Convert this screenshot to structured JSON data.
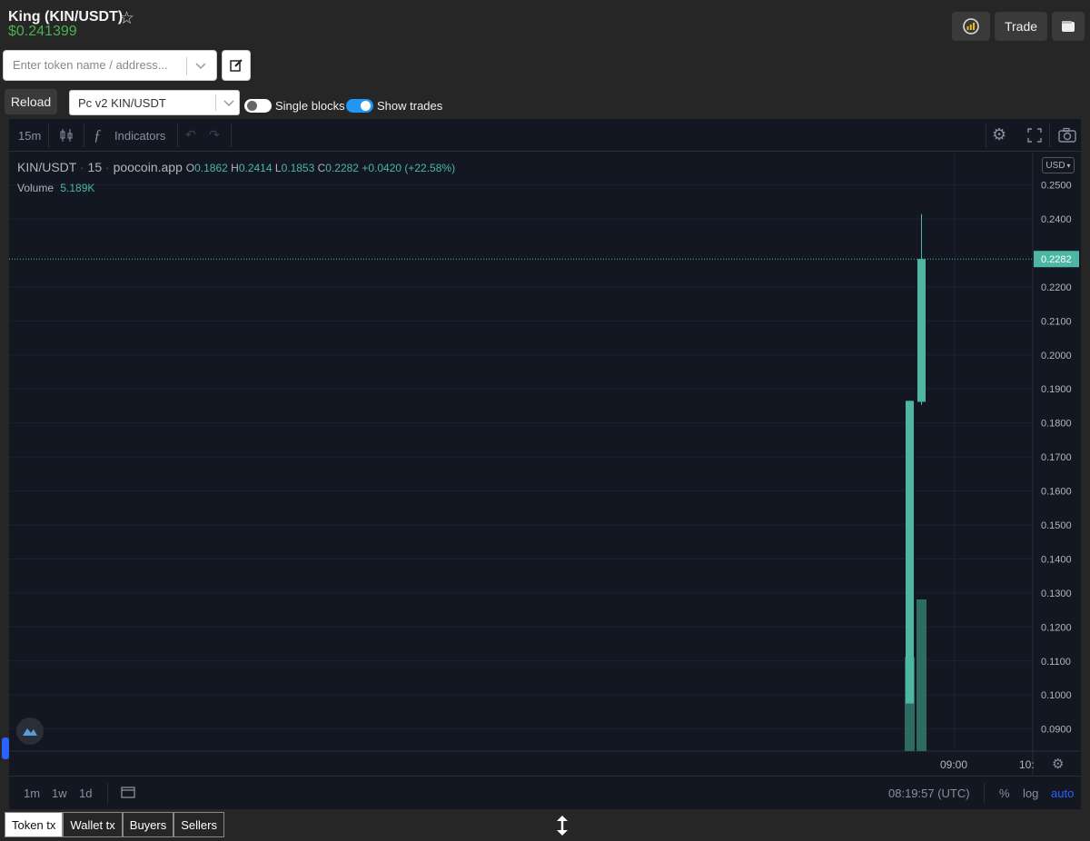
{
  "header": {
    "title": "King (KIN/USDT)",
    "price": "$0.241399",
    "trade_label": "Trade"
  },
  "search": {
    "placeholder": "Enter token name / address..."
  },
  "controls": {
    "reload_label": "Reload",
    "pair_selected": "Pc v2 KIN/USDT",
    "single_blocks_label": "Single blocks",
    "single_blocks_on": false,
    "show_trades_label": "Show trades",
    "show_trades_on": true
  },
  "chart_toolbar": {
    "interval": "15m",
    "indicators_label": "Indicators"
  },
  "legend": {
    "symbol": "KIN/USDT",
    "interval": "15",
    "source": "poocoin.app",
    "o_label": "O",
    "o": "0.1862",
    "h_label": "H",
    "h": "0.2414",
    "l_label": "L",
    "l": "0.1853",
    "c_label": "C",
    "c": "0.2282",
    "change": "+0.0420 (+22.58%)",
    "volume_label": "Volume",
    "volume": "5.189K"
  },
  "axis": {
    "currency": "USD",
    "current_price_tag": "0.2282",
    "time_ticks": [
      "09:00",
      "10:"
    ]
  },
  "chart_data": {
    "type": "candlestick",
    "y_ticks": [
      "0.2500",
      "0.2400",
      "0.2200",
      "0.2100",
      "0.2000",
      "0.1900",
      "0.1800",
      "0.1700",
      "0.1600",
      "0.1500",
      "0.1400",
      "0.1300",
      "0.1200",
      "0.1100",
      "0.1000",
      "0.0900"
    ],
    "ylim": [
      0.0835,
      0.2555
    ],
    "current_price": 0.2282,
    "candles": [
      {
        "open": 0.0975,
        "high": 0.1865,
        "low": 0.0975,
        "close": 0.1865
      },
      {
        "open": 0.1862,
        "high": 0.2414,
        "low": 0.1853,
        "close": 0.2282
      }
    ],
    "volume_bars": [
      0.62,
      1.0
    ]
  },
  "bottom_toolbar": {
    "ranges": [
      "1m",
      "1w",
      "1d"
    ],
    "clock": "08:19:57 (UTC)",
    "pct_label": "%",
    "log_label": "log",
    "auto_label": "auto"
  },
  "tabs": [
    "Token tx",
    "Wallet tx",
    "Buyers",
    "Sellers"
  ],
  "colors": {
    "up": "#4db6a4",
    "price_green": "#4caf50",
    "accent_blue": "#2962ff"
  }
}
